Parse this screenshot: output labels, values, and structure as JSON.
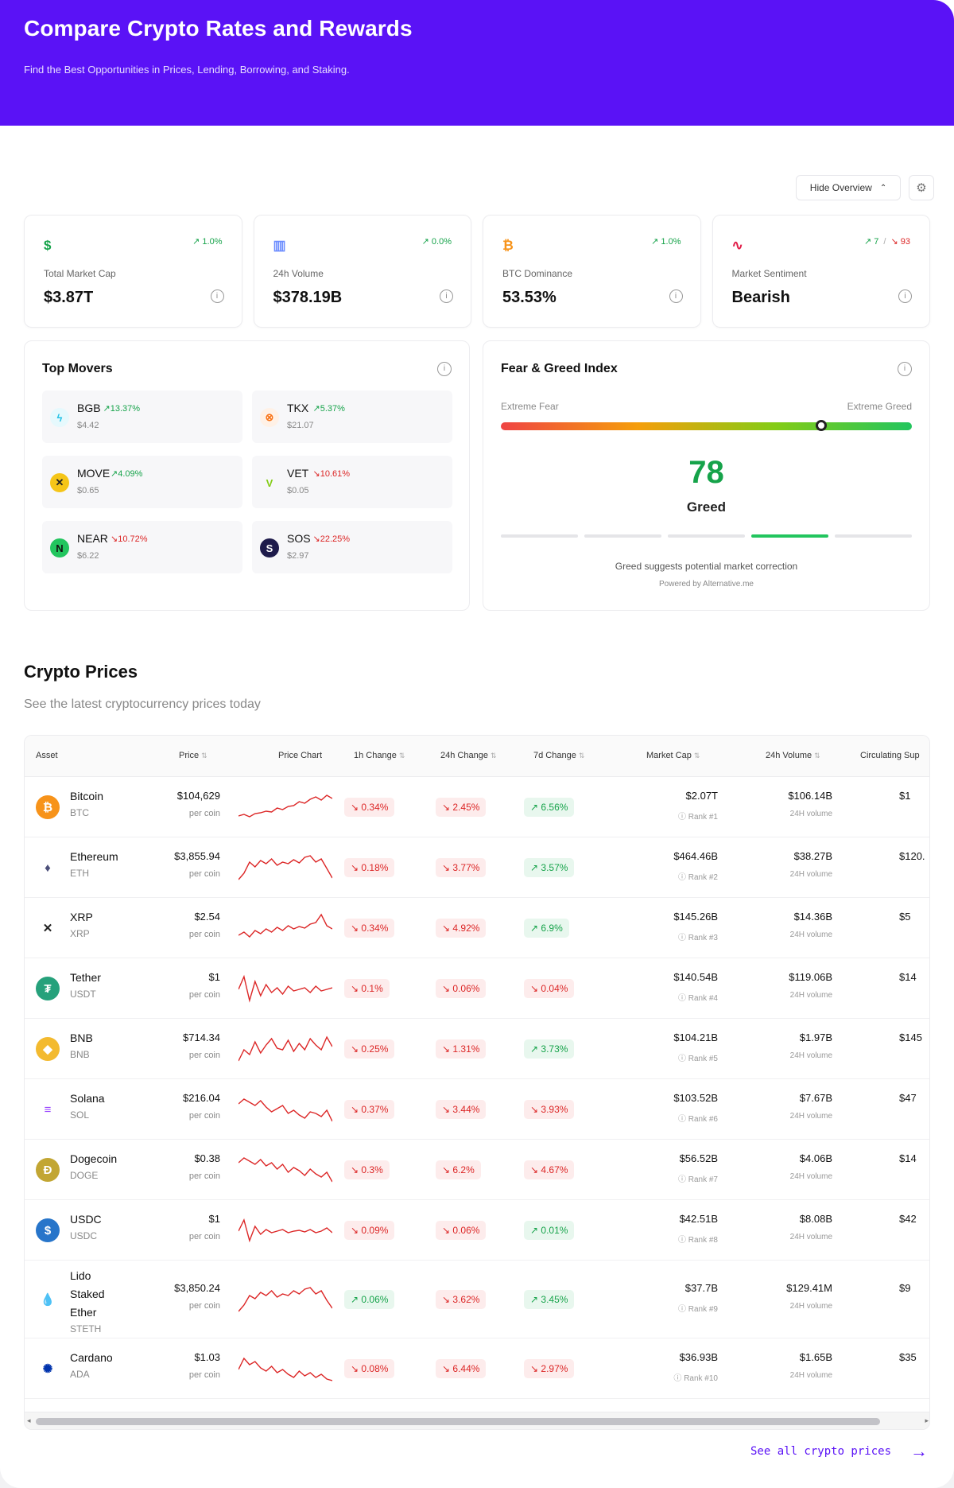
{
  "hero": {
    "title": "Compare Crypto Rates and Rewards",
    "subtitle": "Find the Best Opportunities in Prices, Lending, Borrowing, and Staking."
  },
  "overview": {
    "toggle_label": "Hide Overview",
    "toggle_icon": "chevron-up-icon",
    "settings_icon": "gear-icon"
  },
  "stats": [
    {
      "icon": "dollar-icon",
      "glyph": "$",
      "color": "#16a34a",
      "change": "1.0%",
      "label": "Total Market Cap",
      "value": "$3.87T"
    },
    {
      "icon": "bar-chart-icon",
      "glyph": "▥",
      "color": "#6b8cff",
      "change": "0.0%",
      "label": "24h Volume",
      "value": "$378.19B"
    },
    {
      "icon": "bitcoin-icon",
      "glyph": "₿",
      "color": "#f7931a",
      "change": "1.0%",
      "label": "BTC Dominance",
      "value": "53.53%"
    },
    {
      "icon": "pulse-icon",
      "glyph": "∿",
      "color": "#e11d48",
      "change_up": "7",
      "change_sep": "/",
      "change_down": "93",
      "label": "Market Sentiment",
      "value": "Bearish"
    }
  ],
  "movers": {
    "title": "Top Movers",
    "items": [
      {
        "symbol": "BGB",
        "change": "13.37%",
        "dir": "up",
        "price": "$4.42",
        "icon": "bgb-icon",
        "glyph": "ϟ",
        "color": "#22c1e6",
        "bg": "#e6f9fd"
      },
      {
        "symbol": "TKX",
        "change": "5.37%",
        "dir": "up",
        "price": "$21.07",
        "icon": "tkx-icon",
        "glyph": "⊗",
        "color": "#f97316",
        "bg": "#fff1e6"
      },
      {
        "symbol": "MOVE",
        "change": "4.09%",
        "dir": "up",
        "price": "$0.65",
        "icon": "move-icon",
        "glyph": "✕",
        "color": "#222",
        "bg": "#f5c518"
      },
      {
        "symbol": "VET",
        "change": "10.61%",
        "dir": "down",
        "price": "$0.05",
        "icon": "vet-icon",
        "glyph": "V",
        "color": "#84cc16",
        "bg": "#f7f7f9"
      },
      {
        "symbol": "NEAR",
        "change": "10.72%",
        "dir": "down",
        "price": "$6.22",
        "icon": "near-icon",
        "glyph": "N",
        "color": "#111",
        "bg": "#22c55e"
      },
      {
        "symbol": "SOS",
        "change": "22.25%",
        "dir": "down",
        "price": "$2.97",
        "icon": "sos-icon",
        "glyph": "S",
        "color": "#fff",
        "bg": "#1e1b4b"
      }
    ]
  },
  "fear_greed": {
    "title": "Fear & Greed Index",
    "left_label": "Extreme Fear",
    "right_label": "Extreme Greed",
    "value": "78",
    "value_fraction": 0.78,
    "label": "Greed",
    "active_segment": 3,
    "note": "Greed suggests potential market correction",
    "powered": "Powered by Alternative.me"
  },
  "prices": {
    "title": "Crypto Prices",
    "subtitle": "See the latest cryptocurrency prices today",
    "headers": {
      "asset": "Asset",
      "price": "Price",
      "chart": "Price Chart",
      "h1": "1h Change",
      "h24": "24h Change",
      "d7": "7d Change",
      "mcap": "Market Cap",
      "vol": "24h Volume",
      "circ": "Circulating Sup"
    },
    "per_coin": "per coin",
    "vol_label": "24H volume",
    "rows": [
      {
        "name": [
          "Bitcoin"
        ],
        "symbol": "BTC",
        "icon": "bitcoin-icon",
        "glyph": "₿",
        "bg": "#f7931a",
        "fg": "#fff",
        "price": "$104,629",
        "h1": "0.34%",
        "h1d": "down",
        "h24": "2.45%",
        "h24d": "down",
        "d7": "6.56%",
        "d7d": "up",
        "mcap": "$2.07T",
        "rank": "Rank #1",
        "vol": "$106.14B",
        "circ": "$1",
        "spark": [
          30,
          28,
          31,
          27,
          26,
          24,
          25,
          20,
          22,
          18,
          17,
          12,
          14,
          9,
          6,
          10,
          4,
          8
        ]
      },
      {
        "name": [
          "Ethereum"
        ],
        "symbol": "ETH",
        "icon": "ethereum-icon",
        "glyph": "♦",
        "bg": "#ffffff",
        "fg": "#4c4f7a",
        "price": "$3,855.94",
        "h1": "0.18%",
        "h1d": "down",
        "h24": "3.77%",
        "h24d": "down",
        "d7": "3.57%",
        "d7d": "up",
        "mcap": "$464.46B",
        "rank": "Rank #2",
        "vol": "$38.27B",
        "circ": "$120.",
        "spark": [
          34,
          26,
          12,
          18,
          10,
          14,
          8,
          16,
          12,
          14,
          9,
          13,
          6,
          4,
          12,
          8,
          20,
          32
        ]
      },
      {
        "name": [
          "XRP"
        ],
        "symbol": "XRP",
        "icon": "xrp-icon",
        "glyph": "✕",
        "bg": "#ffffff",
        "fg": "#222",
        "price": "$2.54",
        "h1": "0.34%",
        "h1d": "down",
        "h24": "4.92%",
        "h24d": "down",
        "d7": "6.9%",
        "d7d": "up",
        "mcap": "$145.26B",
        "rank": "Rank #3",
        "vol": "$14.36B",
        "circ": "$5",
        "spark": [
          28,
          24,
          30,
          22,
          26,
          20,
          24,
          18,
          22,
          16,
          20,
          17,
          19,
          14,
          12,
          2,
          16,
          20
        ]
      },
      {
        "name": [
          "Tether"
        ],
        "symbol": "USDT",
        "icon": "tether-icon",
        "glyph": "₮",
        "bg": "#26a17b",
        "fg": "#fff",
        "price": "$1",
        "h1": "0.1%",
        "h1d": "down",
        "h24": "0.06%",
        "h24d": "down",
        "d7": "0.04%",
        "d7d": "down",
        "mcap": "$140.54B",
        "rank": "Rank #4",
        "vol": "$119.06B",
        "circ": "$14",
        "spark": [
          20,
          4,
          34,
          10,
          28,
          14,
          24,
          18,
          26,
          16,
          22,
          20,
          18,
          24,
          16,
          22,
          20,
          18
        ]
      },
      {
        "name": [
          "BNB"
        ],
        "symbol": "BNB",
        "icon": "bnb-icon",
        "glyph": "◆",
        "bg": "#f3ba2f",
        "fg": "#fff",
        "price": "$714.34",
        "h1": "0.25%",
        "h1d": "down",
        "h24": "1.31%",
        "h24d": "down",
        "d7": "3.73%",
        "d7d": "up",
        "mcap": "$104.21B",
        "rank": "Rank #5",
        "vol": "$1.97B",
        "circ": "$145",
        "spark": [
          34,
          20,
          26,
          10,
          24,
          14,
          6,
          18,
          20,
          8,
          22,
          12,
          20,
          6,
          14,
          20,
          4,
          16
        ]
      },
      {
        "name": [
          "Solana"
        ],
        "symbol": "SOL",
        "icon": "solana-icon",
        "glyph": "≡",
        "bg": "#ffffff",
        "fg": "#9945ff",
        "price": "$216.04",
        "h1": "0.37%",
        "h1d": "down",
        "h24": "3.44%",
        "h24d": "down",
        "d7": "3.93%",
        "d7d": "down",
        "mcap": "$103.52B",
        "rank": "Rank #6",
        "vol": "$7.67B",
        "circ": "$47",
        "spark": [
          12,
          6,
          10,
          14,
          8,
          16,
          22,
          18,
          14,
          24,
          20,
          26,
          30,
          22,
          24,
          28,
          20,
          34
        ]
      },
      {
        "name": [
          "Dogecoin"
        ],
        "symbol": "DOGE",
        "icon": "dogecoin-icon",
        "glyph": "Ð",
        "bg": "#c2a633",
        "fg": "#fff",
        "price": "$0.38",
        "h1": "0.3%",
        "h1d": "down",
        "h24": "6.2%",
        "h24d": "down",
        "d7": "4.67%",
        "d7d": "down",
        "mcap": "$56.52B",
        "rank": "Rank #7",
        "vol": "$4.06B",
        "circ": "$14",
        "spark": [
          10,
          4,
          8,
          12,
          6,
          14,
          10,
          18,
          12,
          22,
          16,
          20,
          26,
          18,
          24,
          28,
          22,
          34
        ]
      },
      {
        "name": [
          "USDC"
        ],
        "symbol": "USDC",
        "icon": "usdc-icon",
        "glyph": "$",
        "bg": "#2775ca",
        "fg": "#fff",
        "price": "$1",
        "h1": "0.09%",
        "h1d": "down",
        "h24": "0.06%",
        "h24d": "down",
        "d7": "0.01%",
        "d7d": "up",
        "mcap": "$42.51B",
        "rank": "Rank #8",
        "vol": "$8.08B",
        "circ": "$42",
        "spark": [
          20,
          6,
          32,
          14,
          24,
          18,
          22,
          20,
          18,
          22,
          20,
          19,
          21,
          18,
          22,
          20,
          16,
          22
        ]
      },
      {
        "name": [
          "Lido",
          "Staked",
          "Ether"
        ],
        "symbol": "STETH",
        "icon": "lido-icon",
        "glyph": "💧",
        "bg": "#ffffff",
        "fg": "#00a3ff",
        "price": "$3,850.24",
        "h1": "0.06%",
        "h1d": "up",
        "h24": "3.62%",
        "h24d": "down",
        "d7": "3.45%",
        "d7d": "up",
        "mcap": "$37.7B",
        "rank": "Rank #9",
        "vol": "$129.41M",
        "circ": "$9",
        "spark": [
          34,
          26,
          14,
          18,
          10,
          14,
          8,
          16,
          12,
          14,
          8,
          12,
          6,
          4,
          12,
          8,
          20,
          30
        ]
      },
      {
        "name": [
          "Cardano"
        ],
        "symbol": "ADA",
        "icon": "cardano-icon",
        "glyph": "✺",
        "bg": "#ffffff",
        "fg": "#0033ad",
        "price": "$1.03",
        "h1": "0.08%",
        "h1d": "down",
        "h24": "6.44%",
        "h24d": "down",
        "d7": "2.97%",
        "d7d": "down",
        "mcap": "$36.93B",
        "rank": "Rank #10",
        "vol": "$1.65B",
        "circ": "$35",
        "spark": [
          20,
          6,
          14,
          10,
          18,
          22,
          16,
          24,
          20,
          26,
          30,
          22,
          28,
          24,
          30,
          26,
          32,
          34
        ]
      }
    ],
    "see_all": "See all crypto prices"
  }
}
